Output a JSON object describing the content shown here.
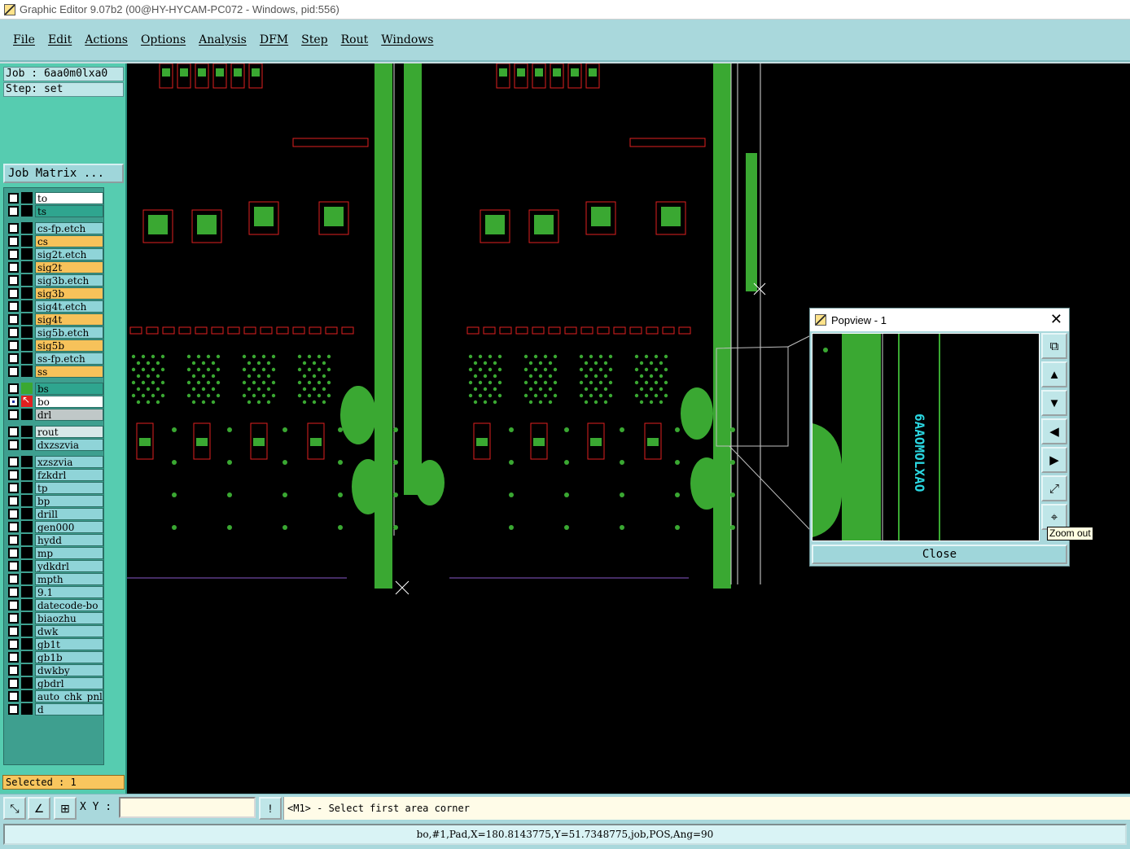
{
  "window": {
    "title": "Graphic Editor 9.07b2 (00@HY-HYCAM-PC072 - Windows, pid:556)"
  },
  "menu": [
    "File",
    "Edit",
    "Actions",
    "Options",
    "Analysis",
    "DFM",
    "Step",
    "Rout",
    "Windows"
  ],
  "job": {
    "job_line": "Job : 6aa0m0lxa0",
    "step_line": "Step: set",
    "matrix_button": "Job Matrix ..."
  },
  "layers": [
    {
      "name": "to",
      "bg": "white",
      "swatch": "black",
      "checked": false
    },
    {
      "name": "ts",
      "bg": "teal",
      "swatch": "black",
      "checked": false
    },
    {
      "name": "cs-fp.etch",
      "bg": "cyan",
      "swatch": "black",
      "checked": false
    },
    {
      "name": "cs",
      "bg": "orange",
      "swatch": "black",
      "checked": false
    },
    {
      "name": "sig2t.etch",
      "bg": "cyan",
      "swatch": "black",
      "checked": false
    },
    {
      "name": "sig2t",
      "bg": "orange",
      "swatch": "black",
      "checked": false
    },
    {
      "name": "sig3b.etch",
      "bg": "cyan",
      "swatch": "black",
      "checked": false
    },
    {
      "name": "sig3b",
      "bg": "orange",
      "swatch": "black",
      "checked": false
    },
    {
      "name": "sig4t.etch",
      "bg": "cyan",
      "swatch": "black",
      "checked": false
    },
    {
      "name": "sig4t",
      "bg": "orange",
      "swatch": "black",
      "checked": false
    },
    {
      "name": "sig5b.etch",
      "bg": "cyan",
      "swatch": "black",
      "checked": false
    },
    {
      "name": "sig5b",
      "bg": "orange",
      "swatch": "black",
      "checked": false
    },
    {
      "name": "ss-fp.etch",
      "bg": "cyan",
      "swatch": "black",
      "checked": false
    },
    {
      "name": "ss",
      "bg": "orange",
      "swatch": "black",
      "checked": false
    },
    {
      "name": "bs",
      "bg": "teal",
      "swatch": "green",
      "checked": false
    },
    {
      "name": "bo",
      "bg": "white",
      "swatch": "red",
      "checked": true
    },
    {
      "name": "drl",
      "bg": "grey",
      "swatch": "black",
      "checked": false
    },
    {
      "name": "rout",
      "bg": "light",
      "swatch": "black",
      "checked": false
    },
    {
      "name": "dxzszvia",
      "bg": "cyan",
      "swatch": "black",
      "checked": false
    },
    {
      "name": "xzszvia",
      "bg": "cyan",
      "swatch": "black",
      "checked": false
    },
    {
      "name": "fzkdrl",
      "bg": "cyan",
      "swatch": "black",
      "checked": false
    },
    {
      "name": "tp",
      "bg": "cyan",
      "swatch": "black",
      "checked": false
    },
    {
      "name": "bp",
      "bg": "cyan",
      "swatch": "black",
      "checked": false
    },
    {
      "name": "drill",
      "bg": "cyan",
      "swatch": "black",
      "checked": false
    },
    {
      "name": "gen000",
      "bg": "cyan",
      "swatch": "black",
      "checked": false
    },
    {
      "name": "hydd",
      "bg": "cyan",
      "swatch": "black",
      "checked": false
    },
    {
      "name": "mp",
      "bg": "cyan",
      "swatch": "black",
      "checked": false
    },
    {
      "name": "ydkdrl",
      "bg": "cyan",
      "swatch": "black",
      "checked": false
    },
    {
      "name": "mpth",
      "bg": "cyan",
      "swatch": "black",
      "checked": false
    },
    {
      "name": "9.1",
      "bg": "cyan",
      "swatch": "black",
      "checked": false
    },
    {
      "name": "datecode-bo",
      "bg": "cyan",
      "swatch": "black",
      "checked": false
    },
    {
      "name": "biaozhu",
      "bg": "cyan",
      "swatch": "black",
      "checked": false
    },
    {
      "name": "dwk",
      "bg": "cyan",
      "swatch": "black",
      "checked": false
    },
    {
      "name": "gb1t",
      "bg": "cyan",
      "swatch": "black",
      "checked": false
    },
    {
      "name": "gb1b",
      "bg": "cyan",
      "swatch": "black",
      "checked": false
    },
    {
      "name": "dwkby",
      "bg": "cyan",
      "swatch": "black",
      "checked": false
    },
    {
      "name": "gbdrl",
      "bg": "cyan",
      "swatch": "black",
      "checked": false
    },
    {
      "name": "auto_chk_pnl",
      "bg": "cyan",
      "swatch": "black",
      "checked": false
    },
    {
      "name": "d",
      "bg": "cyan",
      "swatch": "black",
      "checked": false
    }
  ],
  "selected": "Selected : 1",
  "popview": {
    "title": "Popview - 1",
    "close_label": "Close",
    "marking_text": "6AAOMOLXAO",
    "tooltip": "Zoom out",
    "buttons": [
      "zoom-in-icon",
      "pan-up-icon",
      "pan-down-icon",
      "pan-left-icon",
      "pan-right-icon",
      "fit-icon",
      "zoom-out-icon"
    ]
  },
  "toolbar": {
    "xy_label": "X Y :",
    "xy_value": "",
    "message": "<M1> - Select first area corner"
  },
  "status": {
    "text": "bo,#1,Pad,X=180.8143775,Y=51.7348775,job,POS,Ang=90"
  },
  "colors": {
    "copper_green": "#3aa832",
    "silkscreen_red": "#e02020",
    "panel_bg": "#56ccb0",
    "menu_bg": "#a9d8dc",
    "marking_cyan": "#2ad6e0"
  }
}
